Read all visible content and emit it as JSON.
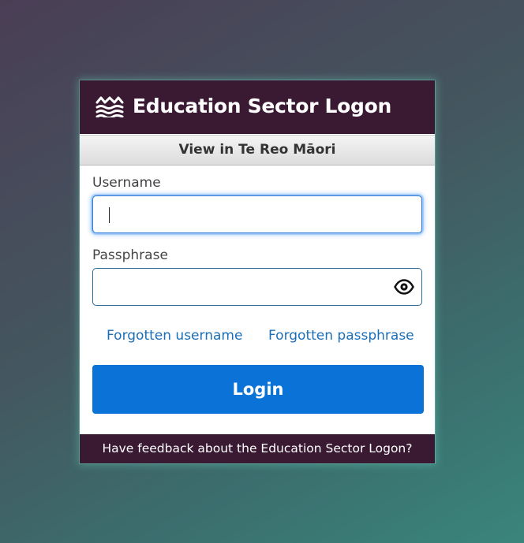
{
  "header": {
    "title": "Education Sector Logon",
    "logo_icon": "waves-logo-icon"
  },
  "language_toggle": {
    "label": "View in Te Reo Māori"
  },
  "form": {
    "username": {
      "label": "Username",
      "value": "",
      "placeholder": ""
    },
    "passphrase": {
      "label": "Passphrase",
      "value": "",
      "placeholder": "",
      "toggle_icon": "eye-icon"
    },
    "links": {
      "forgot_username": "Forgotten username",
      "forgot_passphrase": "Forgotten passphrase"
    },
    "login_label": "Login"
  },
  "footer": {
    "feedback_text": "Have feedback about the Education Sector Logon?"
  },
  "colors": {
    "brand": "#3a1a33",
    "primary_button": "#0b72d8",
    "link": "#1a6fb8",
    "focus_ring": "#2a7ad5"
  }
}
